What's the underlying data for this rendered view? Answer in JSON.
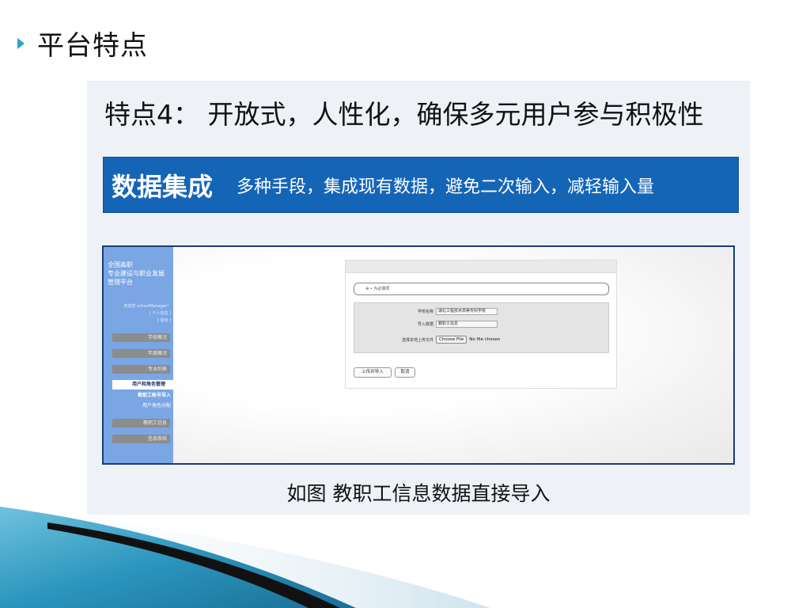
{
  "slide": {
    "title": "平台特点",
    "feature_title": "特点4： 开放式，人性化，确保多元用户参与积极性",
    "banner": {
      "strong": "数据集成",
      "sub": "多种手段，集成现有数据，避免二次输入，减轻输入量"
    },
    "caption": "如图  教职工信息数据直接导入",
    "colors": {
      "bullet": "#2aa6c8",
      "banner": "#1565b7",
      "sidebar": "#7aa6e4",
      "screenshot_border": "#1b3b78"
    }
  },
  "screenshot": {
    "sidebar": {
      "title_lines": [
        "全国高职",
        "专业建设与职业发展",
        "管理平台"
      ],
      "user_lines": [
        "欢迎您 schoolManager！",
        "[ 个人信息 ]",
        "[ 退出 ]"
      ],
      "menu": [
        "学校概况",
        "年度概况",
        "专业列表"
      ],
      "active_menu": "用户和角色管理",
      "submenu": [
        "教职工帐号导入",
        "用户角色分配"
      ],
      "menu_bottom": [
        "教职工信息",
        "信息审核"
      ]
    },
    "card": {
      "help_text": "⊕ • 为必填项",
      "fields": [
        {
          "label": "学校名称",
          "value": "湖北工程技术高等专科学校"
        },
        {
          "label": "导入数据",
          "value": "教职工信息"
        }
      ],
      "file_label": "选择本地上传文件",
      "choose_file": "Choose File",
      "no_file": "No file chosen",
      "submit": "上传并导入",
      "cancel": "取消"
    }
  }
}
